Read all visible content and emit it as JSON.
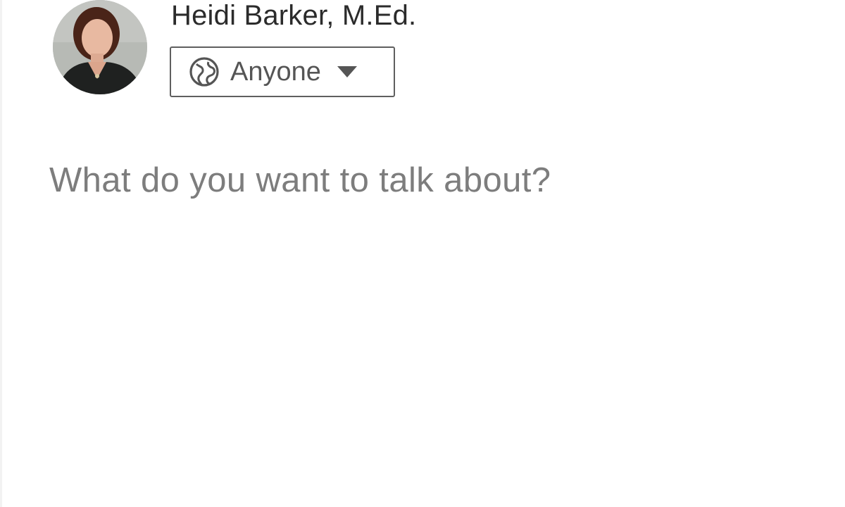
{
  "author": {
    "name": "Heidi Barker, M.Ed.",
    "avatar_icon": "profile-photo"
  },
  "visibility": {
    "label": "Anyone",
    "icon": "globe-icon",
    "dropdown_icon": "caret-down-icon"
  },
  "composer": {
    "value": "",
    "placeholder": "What do you want to talk about?"
  },
  "colors": {
    "text": "#2b2b2b",
    "placeholder": "#7d7d7d",
    "border": "#5f5f5f"
  }
}
